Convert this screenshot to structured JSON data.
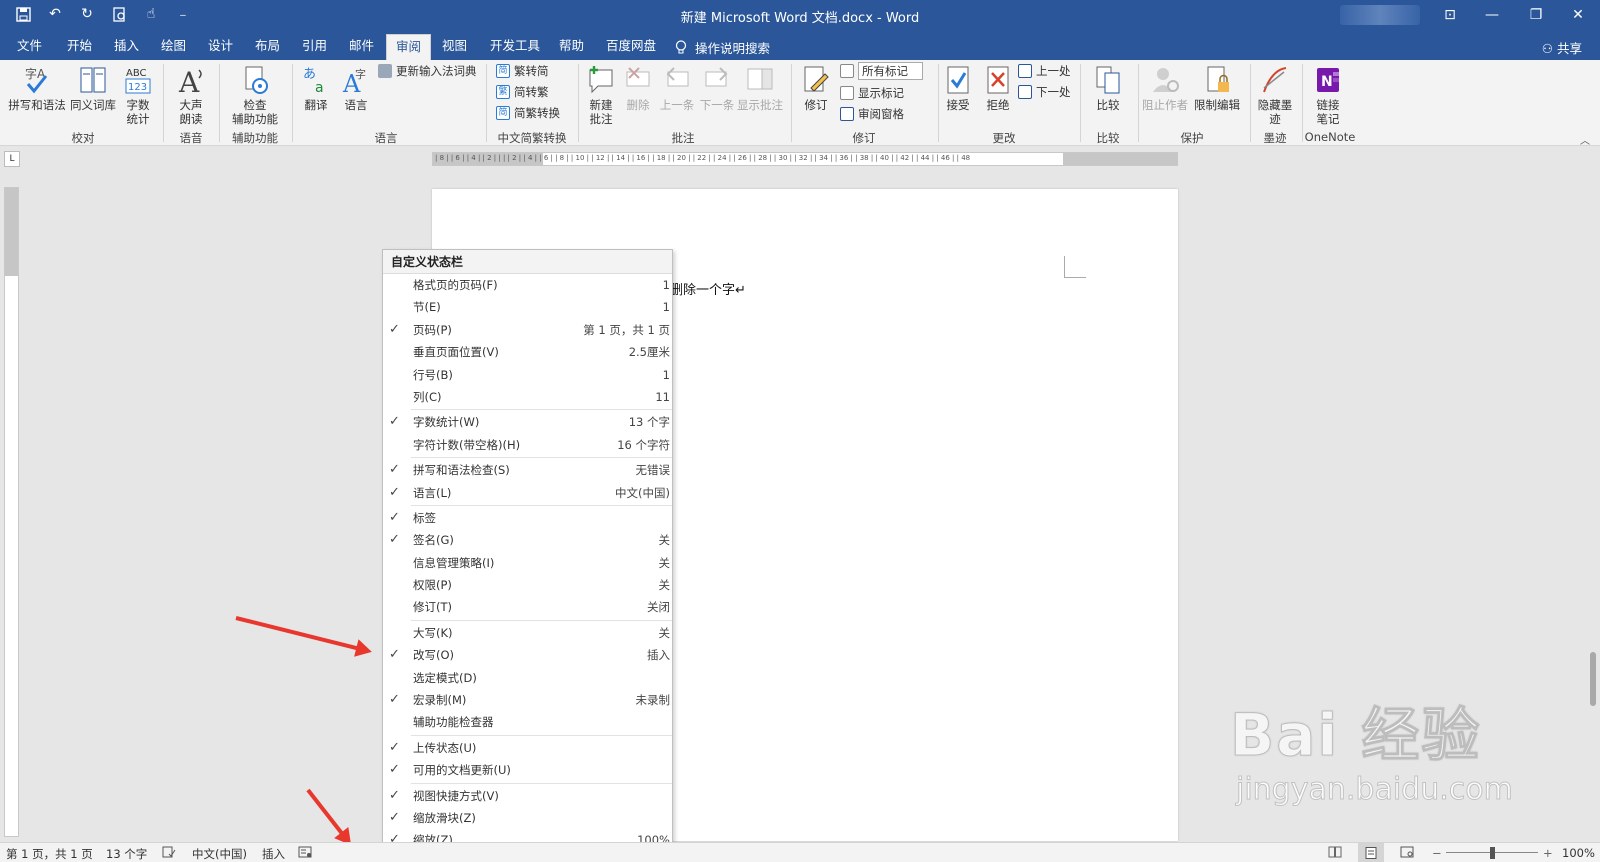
{
  "title": "新建 Microsoft Word 文档.docx  -  Word",
  "qat_more": "₋",
  "window_controls": {
    "ribbon_display": "⊡",
    "minimize": "—",
    "restore": "❐",
    "close": "✕"
  },
  "tabs": [
    "文件",
    "开始",
    "插入",
    "绘图",
    "设计",
    "布局",
    "引用",
    "邮件",
    "审阅",
    "视图",
    "开发工具",
    "帮助",
    "百度网盘"
  ],
  "active_tab": "审阅",
  "tell_me": "操作说明搜索",
  "share": "共享",
  "ribbon": {
    "proofing": {
      "spelling": "拼写和语法",
      "thesaurus": "同义词库",
      "wordcount_line1": "字数",
      "wordcount_line2": "统计",
      "wordcount_icon_text": "ABC\n123",
      "group": "校对"
    },
    "speech": {
      "read_aloud_line1": "大声",
      "read_aloud_line2": "朗读",
      "group": "语音"
    },
    "accessibility": {
      "check_line1": "检查",
      "check_line2": "辅助功能",
      "group": "辅助功能"
    },
    "language": {
      "translate": "翻译",
      "language": "语言",
      "update_ime": "更新输入法词典",
      "group": "语言"
    },
    "chinese_conv": {
      "to_simplified": "繁转简",
      "to_traditional": "简转繁",
      "conversion": "简繁转换",
      "group": "中文简繁转换"
    },
    "comments": {
      "new_line1": "新建",
      "new_line2": "批注",
      "delete": "删除",
      "prev": "上一条",
      "next": "下一条",
      "show": "显示批注",
      "group": "批注"
    },
    "tracking": {
      "track": "修订",
      "markup_select": "所有标记",
      "show_markup": "显示标记",
      "review_pane": "审阅窗格",
      "group": "修订"
    },
    "changes": {
      "accept": "接受",
      "reject": "拒绝",
      "prev": "上一处",
      "next": "下一处",
      "group": "更改"
    },
    "compare": {
      "compare": "比较",
      "group": "比较"
    },
    "protect": {
      "block_authors": "阻止作者",
      "restrict": "限制编辑",
      "group": "保护"
    },
    "ink": {
      "hide_line1": "隐藏墨",
      "hide_line2": "迹",
      "group": "墨迹"
    },
    "onenote": {
      "linked_line1": "链接",
      "linked_line2": "笔记",
      "group": "OneNote"
    }
  },
  "ruler": {
    "tabstop_glyph": "L",
    "ticks": "| 8 |  | 6 |  | 4 |  | 2 |  |    |  | 2 |  | 4 |  | 6 |  | 8 |  | 10 |  | 12 |  | 14 |  | 16 |  | 18 |  | 20 |  | 22 |  | 24 |  | 26 |  | 28 |  | 30 |  | 32 |  | 34 |  | 36 |  | 38 |  | 40 |  | 42 |  | 44 |  | 46 |  | 48"
  },
  "document": {
    "text": "删除一个字↵"
  },
  "context_menu": {
    "title": "自定义状态栏",
    "groups": [
      [
        {
          "checked": false,
          "label": "格式页的页码(F)",
          "value": "1"
        },
        {
          "checked": false,
          "label": "节(E)",
          "value": "1"
        },
        {
          "checked": true,
          "label": "页码(P)",
          "value": "第 1 页，共 1 页"
        },
        {
          "checked": false,
          "label": "垂直页面位置(V)",
          "value": "2.5厘米"
        },
        {
          "checked": false,
          "label": "行号(B)",
          "value": "1"
        },
        {
          "checked": false,
          "label": "列(C)",
          "value": "11"
        }
      ],
      [
        {
          "checked": true,
          "label": "字数统计(W)",
          "value": "13 个字"
        },
        {
          "checked": false,
          "label": "字符计数(带空格)(H)",
          "value": "16 个字符"
        }
      ],
      [
        {
          "checked": true,
          "label": "拼写和语法检查(S)",
          "value": "无错误"
        },
        {
          "checked": true,
          "label": "语言(L)",
          "value": "中文(中国)"
        }
      ],
      [
        {
          "checked": true,
          "label": "标签",
          "value": ""
        },
        {
          "checked": true,
          "label": "签名(G)",
          "value": "关"
        },
        {
          "checked": false,
          "label": "信息管理策略(I)",
          "value": "关"
        },
        {
          "checked": false,
          "label": "权限(P)",
          "value": "关"
        },
        {
          "checked": false,
          "label": "修订(T)",
          "value": "关闭"
        }
      ],
      [
        {
          "checked": false,
          "label": "大写(K)",
          "value": "关"
        },
        {
          "checked": true,
          "label": "改写(O)",
          "value": "插入"
        },
        {
          "checked": false,
          "label": "选定模式(D)",
          "value": ""
        },
        {
          "checked": true,
          "label": "宏录制(M)",
          "value": "未录制"
        },
        {
          "checked": false,
          "label": "辅助功能检查器",
          "value": ""
        }
      ],
      [
        {
          "checked": true,
          "label": "上传状态(U)",
          "value": ""
        },
        {
          "checked": true,
          "label": "可用的文档更新(U)",
          "value": ""
        }
      ],
      [
        {
          "checked": true,
          "label": "视图快捷方式(V)",
          "value": ""
        },
        {
          "checked": true,
          "label": "缩放滑块(Z)",
          "value": ""
        },
        {
          "checked": true,
          "label": "缩放(Z)",
          "value": "100%"
        }
      ]
    ]
  },
  "status_bar": {
    "page": "第 1 页，共 1 页",
    "words": "13 个字",
    "language": "中文(中国)",
    "insert_mode": "插入",
    "zoom_minus": "−",
    "zoom_plus": "+",
    "zoom": "100%",
    "zoom_level": 0.5
  },
  "watermark": {
    "brand": "Bai  经验",
    "url": "jingyan.baidu.com"
  },
  "colors": {
    "accent": "#2b579a",
    "arrow": "#e8382e",
    "onenote": "#7719aa"
  }
}
